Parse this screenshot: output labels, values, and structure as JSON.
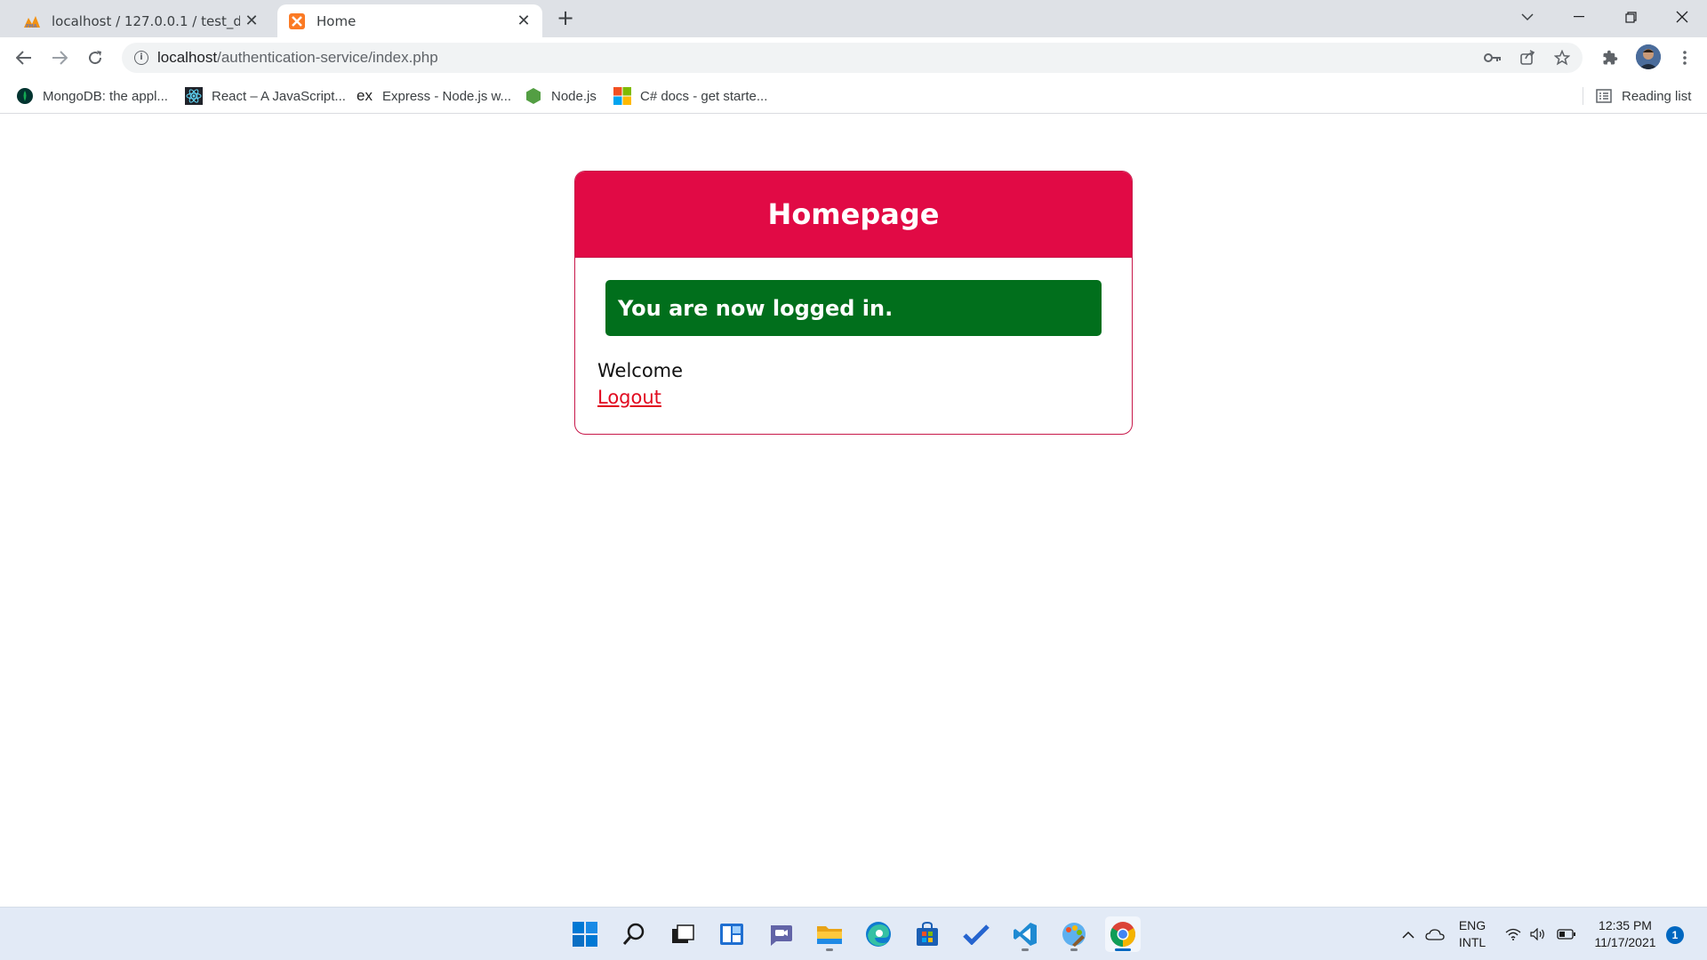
{
  "browser": {
    "tabs": [
      {
        "title": "localhost / 127.0.0.1 / test_datab",
        "favicon": "phpmyadmin-icon",
        "active": false
      },
      {
        "title": "Home",
        "favicon": "xampp-icon",
        "active": true
      }
    ],
    "address_bar": {
      "host": "localhost",
      "path": "/authentication-service/index.php"
    },
    "bookmarks": [
      {
        "label": "MongoDB: the appl...",
        "icon": "mongodb-icon"
      },
      {
        "label": "React – A JavaScript...",
        "icon": "react-icon"
      },
      {
        "label": "Express - Node.js w...",
        "icon": "express-icon"
      },
      {
        "label": "Node.js",
        "icon": "nodejs-icon"
      },
      {
        "label": "C# docs - get starte...",
        "icon": "microsoft-icon"
      }
    ],
    "reading_list_label": "Reading list"
  },
  "page": {
    "title": "Homepage",
    "alert": "You are now logged in.",
    "welcome": "Welcome",
    "logout": "Logout",
    "colors": {
      "header": "#e10a45",
      "alert": "#016f1c",
      "link": "#e10a20"
    }
  },
  "taskbar": {
    "apps": [
      "start-icon",
      "search-icon",
      "task-view-icon",
      "widgets-icon",
      "teams-chat-icon",
      "file-explorer-icon",
      "edge-icon",
      "store-icon",
      "todo-icon",
      "vscode-icon",
      "paint-icon",
      "chrome-icon"
    ],
    "language": {
      "line1": "ENG",
      "line2": "INTL"
    },
    "time": "12:35 PM",
    "date": "11/17/2021",
    "notification_count": "1"
  }
}
